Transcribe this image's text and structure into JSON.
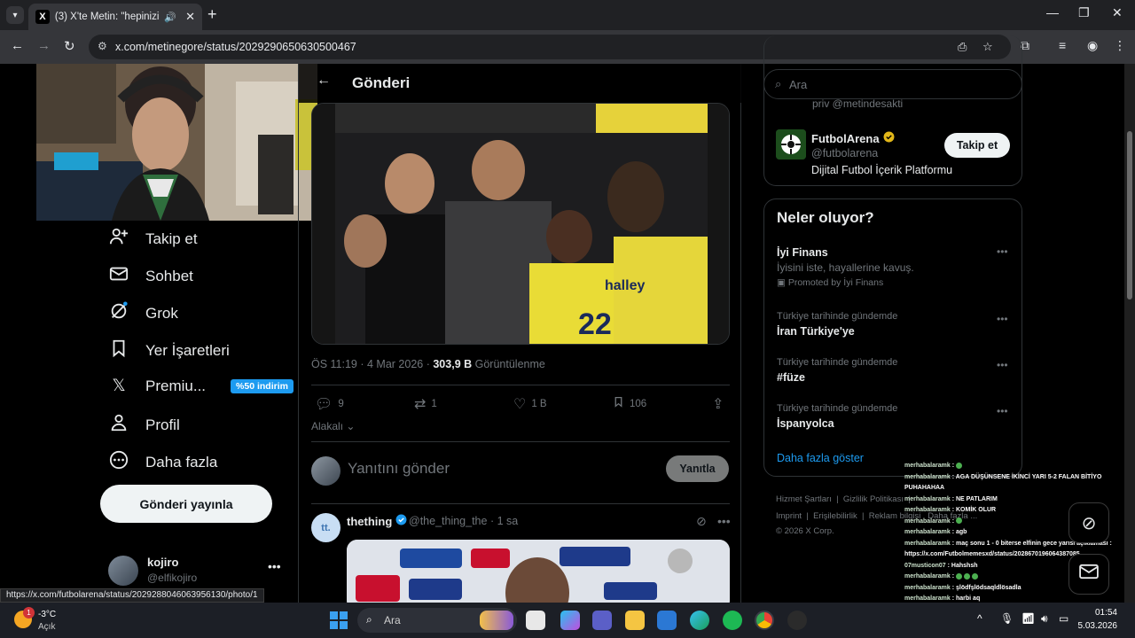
{
  "browser": {
    "tab_title": "(3) X'te Metin: \"hepinizin al",
    "url": "x.com/metinegore/status/2029290650630500467",
    "hover_url": "https://x.com/futbolarena/status/2029288046063956130/photo/1"
  },
  "header": {
    "title": "Gönderi"
  },
  "nav": [
    {
      "label": "Takip et",
      "icon": "person-plus-icon"
    },
    {
      "label": "Sohbet",
      "icon": "envelope-icon"
    },
    {
      "label": "Grok",
      "icon": "grok-icon"
    },
    {
      "label": "Yer İşaretleri",
      "icon": "bookmark-icon"
    },
    {
      "label": "Premiu...",
      "icon": "x-logo-icon",
      "badge": "%50 indirim"
    },
    {
      "label": "Profil",
      "icon": "person-icon"
    },
    {
      "label": "Daha fazla",
      "icon": "more-circle-icon"
    }
  ],
  "post_button": "Gönderi yayınla",
  "account": {
    "name": "kojiro",
    "handle": "@elfikojiro"
  },
  "tweet": {
    "time": "ÖS 11:19 · 4 Mar 2026 ·",
    "views": "303,9 B",
    "views_label": "Görüntülenme",
    "replies": "9",
    "retweets": "1",
    "likes": "1 B",
    "bookmarks": "106",
    "sort_label": "Alakalı"
  },
  "reply": {
    "placeholder": "Yanıtını gönder",
    "button": "Yanıtla"
  },
  "next_tweet": {
    "avatar_text": "tt.",
    "name": "thething",
    "handle": "@the_thing_the",
    "time": "· 1 sa"
  },
  "search": {
    "placeholder": "Ara"
  },
  "who_to_follow": {
    "partial_text": "priv @metindesakti",
    "name": "FutbolArena",
    "handle": "@futbolarena",
    "description": "Dijital Futbol İçerik Platformu",
    "follow": "Takip et"
  },
  "trends": {
    "title": "Neler oluyor?",
    "items": [
      {
        "name": "İyi Finans",
        "desc": "İyisini iste, hayallerine kavuş.",
        "promo": "Promoted by İyi Finans"
      },
      {
        "context": "Türkiye tarihinde gündemde",
        "name": "İran Türkiye'ye"
      },
      {
        "context": "Türkiye tarihinde gündemde",
        "name": "#füze"
      },
      {
        "context": "Türkiye tarihinde gündemde",
        "name": "İspanyolca"
      }
    ],
    "more": "Daha fazla göster"
  },
  "footer": {
    "links": [
      "Hizmet Şartları",
      "Gizlilik Politikası",
      "Imprint",
      "Erişilebilirlik",
      "Reklam bilgisi",
      "Daha fazla ..."
    ],
    "copyright": "© 2026 X Corp."
  },
  "chat": [
    {
      "user": "merhabalaramk",
      "msg": ""
    },
    {
      "user": "merhabalaramk",
      "msg": "AGA DÜŞÜNSENE İKİNCİ YARI 5-2 FALAN BİTİYO PUHAHAHAA"
    },
    {
      "user": "merhabalaramk",
      "msg": "NE PATLARIM"
    },
    {
      "user": "merhabalaramk",
      "msg": "KOMİK OLUR"
    },
    {
      "user": "merhabalaramk",
      "msg": ""
    },
    {
      "user": "merhabalaramk",
      "msg": "agb"
    },
    {
      "user": "merhabalaramk",
      "msg": "maç sonu 1 - 0 biterse elfinin gece yarısı açıklaması : https://x.com/Futbolmemesxd/status/2028670196064387085"
    },
    {
      "user": "07musticon07",
      "msg": "Hahshsh"
    },
    {
      "user": "merhabalaramk",
      "msg": ""
    },
    {
      "user": "merhabalaramk",
      "msg": "şlödfşlödsaqldlösadla"
    },
    {
      "user": "merhabalaramk",
      "msg": "harbi aq"
    }
  ],
  "taskbar": {
    "temp": "-3°C",
    "condition": "Açık",
    "weather_notif": "1",
    "search": "Ara",
    "time": "01:54",
    "date": "5.03.2026"
  }
}
